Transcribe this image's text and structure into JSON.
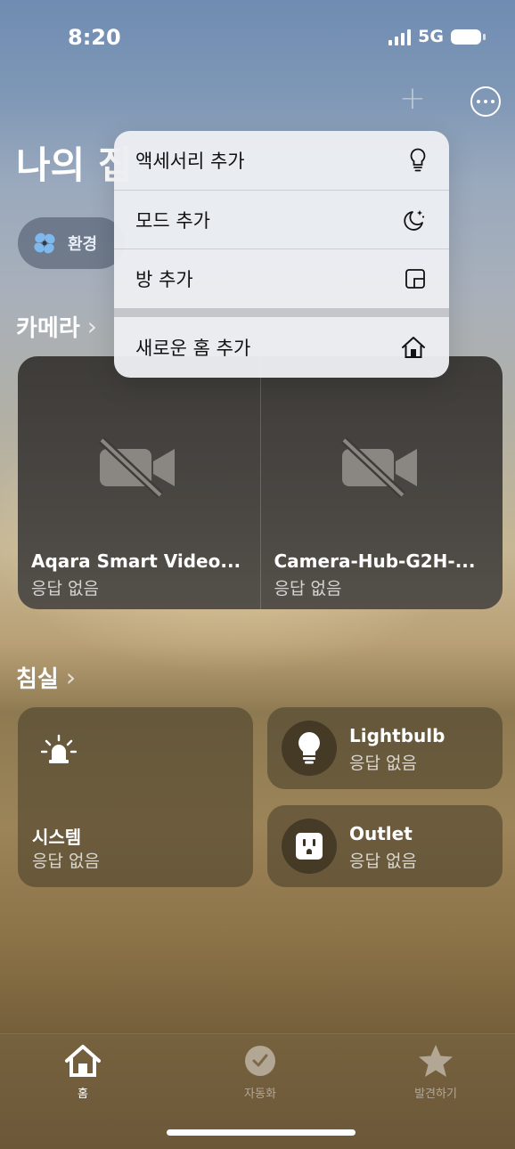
{
  "status_bar": {
    "time": "8:20",
    "network": "5G"
  },
  "page": {
    "title": "나의 집"
  },
  "chips": {
    "environment": "환경"
  },
  "sections": {
    "camera": "카메라",
    "bedroom": "침실"
  },
  "cameras": [
    {
      "name": "Aqara Smart Video...",
      "status": "응답 없음"
    },
    {
      "name": "Camera-Hub-G2H-...",
      "status": "응답 없음"
    }
  ],
  "accessories": {
    "system": {
      "name": "시스템",
      "status": "응답 없음"
    },
    "lightbulb": {
      "name": "Lightbulb",
      "status": "응답 없음"
    },
    "outlet": {
      "name": "Outlet",
      "status": "응답 없음"
    }
  },
  "menu": {
    "items": [
      {
        "label": "액세서리 추가",
        "icon": "lightbulb-icon"
      },
      {
        "label": "모드 추가",
        "icon": "moon-icon"
      },
      {
        "label": "방 추가",
        "icon": "room-icon"
      },
      {
        "label": "새로운 홈 추가",
        "icon": "home-icon"
      }
    ]
  },
  "tabs": [
    {
      "label": "홈",
      "icon": "house-icon",
      "active": true
    },
    {
      "label": "자동화",
      "icon": "clock-icon",
      "active": false
    },
    {
      "label": "발견하기",
      "icon": "star-icon",
      "active": false
    }
  ]
}
